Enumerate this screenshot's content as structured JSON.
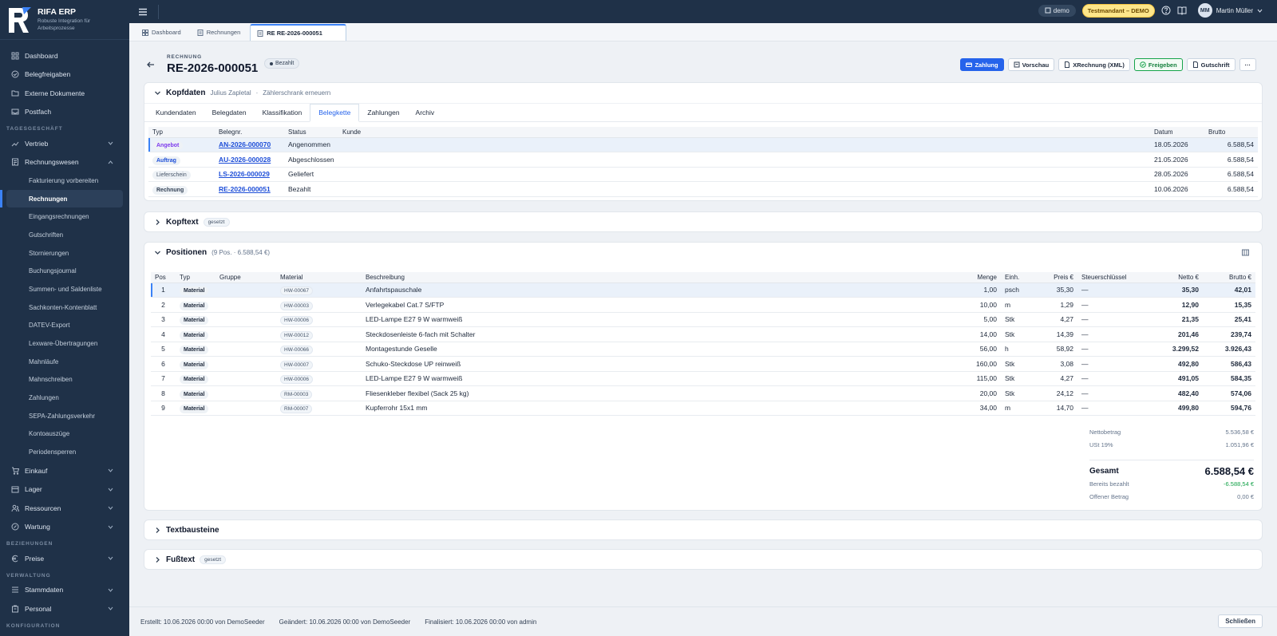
{
  "app": {
    "name": "RIFA ERP",
    "tagline": "Robuste Integration für Arbeitsprozesse"
  },
  "nav": {
    "dashboard": "Dashboard",
    "belegfreigaben": "Belegfreigaben",
    "externe": "Externe Dokumente",
    "postfach": "Postfach",
    "section_tagesgeschaeft": "TAGESGESCHÄFT",
    "vertrieb": "Vertrieb",
    "rechnungswesen": "Rechnungswesen",
    "sub": [
      "Fakturierung vorbereiten",
      "Rechnungen",
      "Eingangsrechnungen",
      "Gutschriften",
      "Stornierungen",
      "Buchungsjournal",
      "Summen- und Saldenliste",
      "Sachkonten-Kontenblatt",
      "DATEV-Export",
      "Lexware-Übertragungen",
      "Mahnläufe",
      "Mahnschreiben",
      "Zahlungen",
      "SEPA-Zahlungsverkehr",
      "Kontoauszüge",
      "Periodensperren"
    ],
    "einkauf": "Einkauf",
    "lager": "Lager",
    "ressourcen": "Ressourcen",
    "wartung": "Wartung",
    "section_beziehungen": "BEZIEHUNGEN",
    "preise": "Preise",
    "section_verwaltung": "VERWALTUNG",
    "stammdaten": "Stammdaten",
    "personal": "Personal",
    "section_konfiguration": "KONFIGURATION"
  },
  "topbar": {
    "demo": "demo",
    "tenant": "Testmandant – DEMO",
    "user_initials": "MM",
    "user_name": "Martin Müller"
  },
  "tabs": {
    "dashboard": "Dashboard",
    "rechnungen": "Rechnungen",
    "current": "RE RE-2026-000051"
  },
  "header": {
    "kind": "RECHNUNG",
    "number": "RE-2026-000051",
    "status": "Bezahlt",
    "actions": {
      "zahlung": "Zahlung",
      "vorschau": "Vorschau",
      "xrechnung": "XRechnung (XML)",
      "freigeben": "Freigeben",
      "gutschrift": "Gutschrift",
      "more": "···"
    }
  },
  "kopfdaten": {
    "title": "Kopfdaten",
    "customer": "Julius Zapletal",
    "subject": "Zählerschrank erneuern",
    "subtabs": [
      "Kundendaten",
      "Belegdaten",
      "Klassifikation",
      "Belegkette",
      "Zahlungen",
      "Archiv"
    ],
    "columns": {
      "typ": "Typ",
      "nr": "Belegnr.",
      "status": "Status",
      "kunde": "Kunde",
      "datum": "Datum",
      "brutto": "Brutto"
    },
    "rows": [
      {
        "typ": "Angebot",
        "nr": "AN-2026-000070",
        "status": "Angenommen",
        "datum": "18.05.2026",
        "brutto": "6.588,54"
      },
      {
        "typ": "Auftrag",
        "nr": "AU-2026-000028",
        "status": "Abgeschlossen",
        "datum": "21.05.2026",
        "brutto": "6.588,54"
      },
      {
        "typ": "Lieferschein",
        "nr": "LS-2026-000029",
        "status": "Geliefert",
        "datum": "28.05.2026",
        "brutto": "6.588,54"
      },
      {
        "typ": "Rechnung",
        "nr": "RE-2026-000051",
        "status": "Bezahlt",
        "datum": "10.06.2026",
        "brutto": "6.588,54"
      }
    ]
  },
  "kopftext": {
    "title": "Kopftext",
    "tag": "gesetzt"
  },
  "positionen": {
    "title": "Positionen",
    "meta": "(9 Pos. · 6.588,54 €)",
    "columns": {
      "pos": "Pos",
      "typ": "Typ",
      "gruppe": "Gruppe",
      "material": "Material",
      "beschreibung": "Beschreibung",
      "menge": "Menge",
      "einh": "Einh.",
      "preis": "Preis €",
      "steuer": "Steuerschlüssel",
      "netto": "Netto €",
      "brutto": "Brutto €"
    },
    "rows": [
      {
        "pos": "1",
        "typ": "Material",
        "mat": "HW-00067",
        "desc": "Anfahrtspauschale",
        "menge": "1,00",
        "einh": "psch",
        "preis": "35,30",
        "steuer": "—",
        "netto": "35,30",
        "brutto": "42,01"
      },
      {
        "pos": "2",
        "typ": "Material",
        "mat": "HW-00003",
        "desc": "Verlegekabel Cat.7 S/FTP",
        "menge": "10,00",
        "einh": "m",
        "preis": "1,29",
        "steuer": "—",
        "netto": "12,90",
        "brutto": "15,35"
      },
      {
        "pos": "3",
        "typ": "Material",
        "mat": "HW-00006",
        "desc": "LED-Lampe E27 9 W warmweiß",
        "menge": "5,00",
        "einh": "Stk",
        "preis": "4,27",
        "steuer": "—",
        "netto": "21,35",
        "brutto": "25,41"
      },
      {
        "pos": "4",
        "typ": "Material",
        "mat": "HW-00012",
        "desc": "Steckdosenleiste 6-fach mit Schalter",
        "menge": "14,00",
        "einh": "Stk",
        "preis": "14,39",
        "steuer": "—",
        "netto": "201,46",
        "brutto": "239,74"
      },
      {
        "pos": "5",
        "typ": "Material",
        "mat": "HW-00066",
        "desc": "Montagestunde Geselle",
        "menge": "56,00",
        "einh": "h",
        "preis": "58,92",
        "steuer": "—",
        "netto": "3.299,52",
        "brutto": "3.926,43"
      },
      {
        "pos": "6",
        "typ": "Material",
        "mat": "HW-00007",
        "desc": "Schuko-Steckdose UP reinweiß",
        "menge": "160,00",
        "einh": "Stk",
        "preis": "3,08",
        "steuer": "—",
        "netto": "492,80",
        "brutto": "586,43"
      },
      {
        "pos": "7",
        "typ": "Material",
        "mat": "HW-00006",
        "desc": "LED-Lampe E27 9 W warmweiß",
        "menge": "115,00",
        "einh": "Stk",
        "preis": "4,27",
        "steuer": "—",
        "netto": "491,05",
        "brutto": "584,35"
      },
      {
        "pos": "8",
        "typ": "Material",
        "mat": "RM-00003",
        "desc": "Fliesenkleber flexibel (Sack 25 kg)",
        "menge": "20,00",
        "einh": "Stk",
        "preis": "24,12",
        "steuer": "—",
        "netto": "482,40",
        "brutto": "574,06"
      },
      {
        "pos": "9",
        "typ": "Material",
        "mat": "RM-00007",
        "desc": "Kupferrohr 15x1 mm",
        "menge": "34,00",
        "einh": "m",
        "preis": "14,70",
        "steuer": "—",
        "netto": "499,80",
        "brutto": "594,76"
      }
    ],
    "totals": {
      "netto_label": "Nettobetrag",
      "netto": "5.536,58 €",
      "ust_label": "USt 19%",
      "ust": "1.051,96 €",
      "gesamt_label": "Gesamt",
      "gesamt": "6.588,54 €",
      "bezahlt_label": "Bereits bezahlt",
      "bezahlt": "-6.588,54 €",
      "offen_label": "Offener Betrag",
      "offen": "0,00 €"
    }
  },
  "textbausteine": {
    "title": "Textbausteine"
  },
  "fusstext": {
    "title": "Fußtext",
    "tag": "gesetzt"
  },
  "footer": {
    "erstellt": "Erstellt: 10.06.2026 00:00 von DemoSeeder",
    "geaendert": "Geändert: 10.06.2026 00:00 von DemoSeeder",
    "finalisiert": "Finalisiert: 10.06.2026 00:00 von admin",
    "close": "Schließen"
  },
  "colors": {
    "sidebar": "#1f3148",
    "accent": "#2563eb",
    "paid_green": "#16a34a"
  }
}
